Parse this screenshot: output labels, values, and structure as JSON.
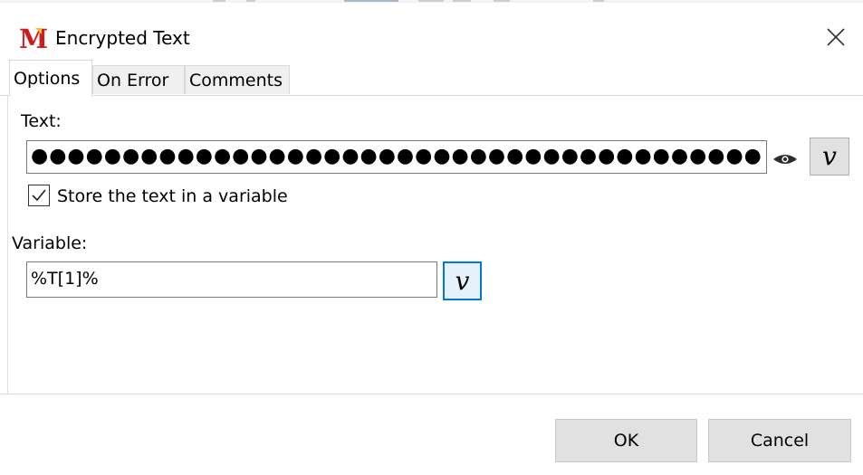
{
  "window": {
    "title": "Encrypted Text",
    "logo_letter": "M"
  },
  "tabs": [
    {
      "label": "Options",
      "active": true
    },
    {
      "label": "On Error",
      "active": false
    },
    {
      "label": "Comments",
      "active": false
    }
  ],
  "text_section": {
    "label": "Text:",
    "masked_value": "●●●●●●●●●●●●●●●●●●●●●●●●●●●●●●●●●●●●●●●●",
    "variable_button_label": "v"
  },
  "store_checkbox": {
    "label": "Store the text in a variable",
    "checked": true
  },
  "variable_section": {
    "label": "Variable:",
    "value": "%T[1]%",
    "variable_button_label": "v"
  },
  "buttons": {
    "ok": "OK",
    "cancel": "Cancel"
  },
  "icons": {
    "close": "close-icon",
    "eye": "eye-icon",
    "check": "checkmark-icon",
    "logo": "app-logo-icon"
  },
  "colors": {
    "logo_red": "#d01c1f",
    "focus_blue": "#0078d7",
    "button_gray": "#e1e1e1"
  }
}
